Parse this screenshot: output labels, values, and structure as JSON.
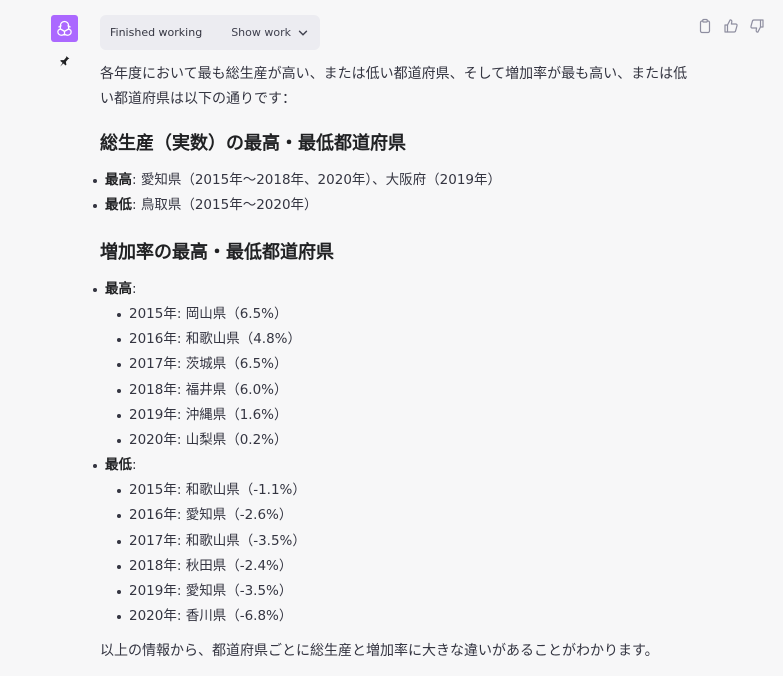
{
  "header": {
    "work_status": "Finished working",
    "show_work_label": "Show work"
  },
  "message": {
    "intro": "各年度において最も総生産が高い、または低い都道府県、そして増加率が最も高い、または低い都道府県は以下の通りです：",
    "section1": {
      "title": "総生産（実数）の最高・最低都道府県",
      "items": [
        {
          "label": "最高",
          "text": ": 愛知県（2015年〜2018年、2020年）、大阪府（2019年）"
        },
        {
          "label": "最低",
          "text": ": 鳥取県（2015年〜2020年）"
        }
      ]
    },
    "section2": {
      "title": "増加率の最高・最低都道府県",
      "high_label": "最高",
      "high_colon": ":",
      "high_items": [
        "2015年: 岡山県（6.5%）",
        "2016年: 和歌山県（4.8%）",
        "2017年: 茨城県（6.5%）",
        "2018年: 福井県（6.0%）",
        "2019年: 沖縄県（1.6%）",
        "2020年: 山梨県（0.2%）"
      ],
      "low_label": "最低",
      "low_colon": ":",
      "low_items": [
        "2015年: 和歌山県（-1.1%）",
        "2016年: 愛知県（-2.6%）",
        "2017年: 和歌山県（-3.5%）",
        "2018年: 秋田県（-2.4%）",
        "2019年: 愛知県（-3.5%）",
        "2020年: 香川県（-6.8%）"
      ]
    },
    "outro": "以上の情報から、都道府県ごとに総生産と増加率に大きな違いがあることがわかります。"
  },
  "icons": {
    "avatar": "openai-logo-icon",
    "pin": "pin-icon",
    "copy": "clipboard-icon",
    "like": "thumbs-up-icon",
    "dislike": "thumbs-down-icon"
  },
  "colors": {
    "avatar_bg": "#ab68ff",
    "page_bg": "#f7f7f8",
    "work_box_bg": "#ececf1"
  }
}
